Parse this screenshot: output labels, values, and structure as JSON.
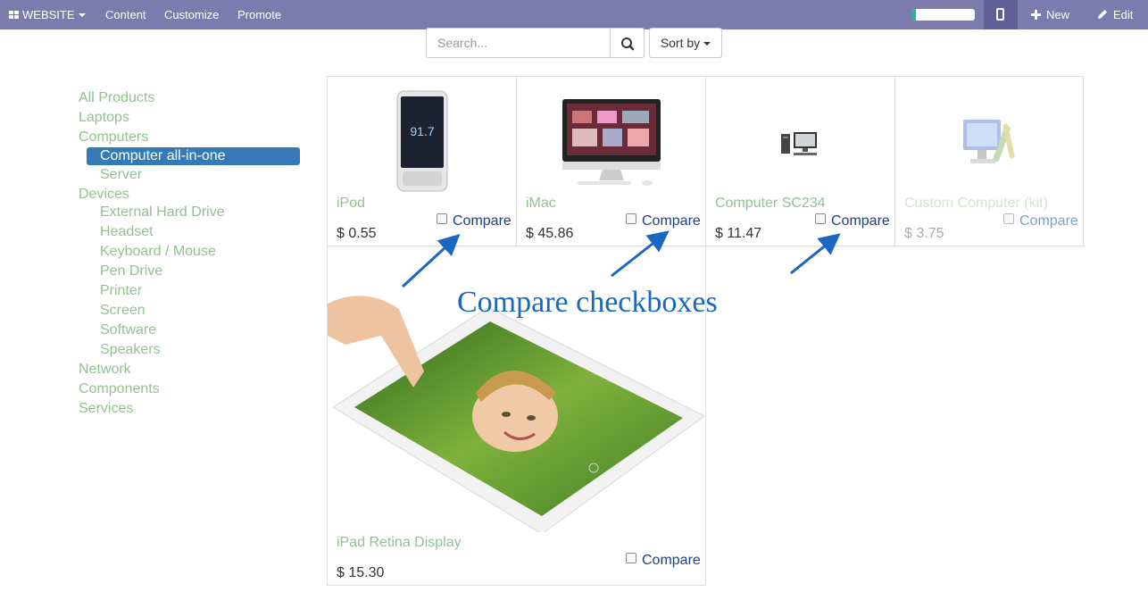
{
  "topbar": {
    "website_label": "WEBSITE",
    "content_label": "Content",
    "customize_label": "Customize",
    "promote_label": "Promote",
    "progress_fraction": 0.05,
    "new_label": "New",
    "edit_label": "Edit",
    "icons": [
      "grid-icon",
      "mobile-icon",
      "plus-icon",
      "pencil-icon"
    ]
  },
  "search": {
    "placeholder": "Search...",
    "sort_label": "Sort by"
  },
  "sidebar": {
    "categories": [
      {
        "label": "All Products",
        "level": 0
      },
      {
        "label": "Laptops",
        "level": 0
      },
      {
        "label": "Computers",
        "level": 0
      },
      {
        "label": "Computer all-in-one",
        "level": 1,
        "active": true
      },
      {
        "label": "Server",
        "level": 1
      },
      {
        "label": "Devices",
        "level": 0
      },
      {
        "label": "External Hard Drive",
        "level": 1
      },
      {
        "label": "Headset",
        "level": 1
      },
      {
        "label": "Keyboard / Mouse",
        "level": 1
      },
      {
        "label": "Pen Drive",
        "level": 1
      },
      {
        "label": "Printer",
        "level": 1
      },
      {
        "label": "Screen",
        "level": 1
      },
      {
        "label": "Software",
        "level": 1
      },
      {
        "label": "Speakers",
        "level": 1
      },
      {
        "label": "Network",
        "level": 0
      },
      {
        "label": "Components",
        "level": 0
      },
      {
        "label": "Services",
        "level": 0
      }
    ]
  },
  "products": [
    {
      "name": "iPod",
      "price": "$ 0.55",
      "compare_label": "Compare"
    },
    {
      "name": "iMac",
      "price": "$ 45.86",
      "compare_label": "Compare"
    },
    {
      "name": "Computer SC234",
      "price": "$ 11.47",
      "compare_label": "Compare"
    },
    {
      "name": "Custom Computer (kit)",
      "price": "$ 3.75",
      "compare_label": "Compare"
    },
    {
      "name": "iPad Retina Display",
      "price": "$ 15.30",
      "compare_label": "Compare"
    }
  ],
  "annotation": {
    "text": "Compare checkboxes",
    "color": "#1a67c2"
  },
  "colors": {
    "topbar": "#7c7bad",
    "category_link": "#8fc48f",
    "active_category": "#337ab7",
    "compare_link": "#1f3f85"
  }
}
